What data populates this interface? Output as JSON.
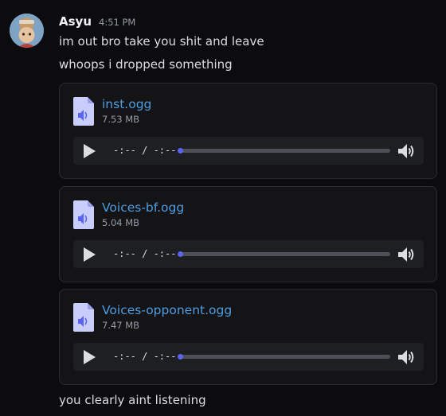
{
  "message": {
    "username": "Asyu",
    "timestamp": "4:51 PM",
    "lines": [
      "im out bro take you shit and leave",
      "whoops i dropped something",
      "you clearly aint listening"
    ]
  },
  "attachments": [
    {
      "filename": "inst.ogg",
      "size": "7.53 MB",
      "time": "-:-- / -:--",
      "progress": 0
    },
    {
      "filename": "Voices-bf.ogg",
      "size": "5.04 MB",
      "time": "-:-- / -:--",
      "progress": 0
    },
    {
      "filename": "Voices-opponent.ogg",
      "size": "7.47 MB",
      "time": "-:-- / -:--",
      "progress": 0
    }
  ],
  "icons": {
    "avatar": "user-avatar",
    "file": "audio-file-icon",
    "play": "play-icon",
    "volume": "volume-icon"
  },
  "colors": {
    "background": "#0c0c0e",
    "link": "#4d9de0",
    "accent": "#5865f2",
    "file_icon": "#c9cdfb"
  }
}
